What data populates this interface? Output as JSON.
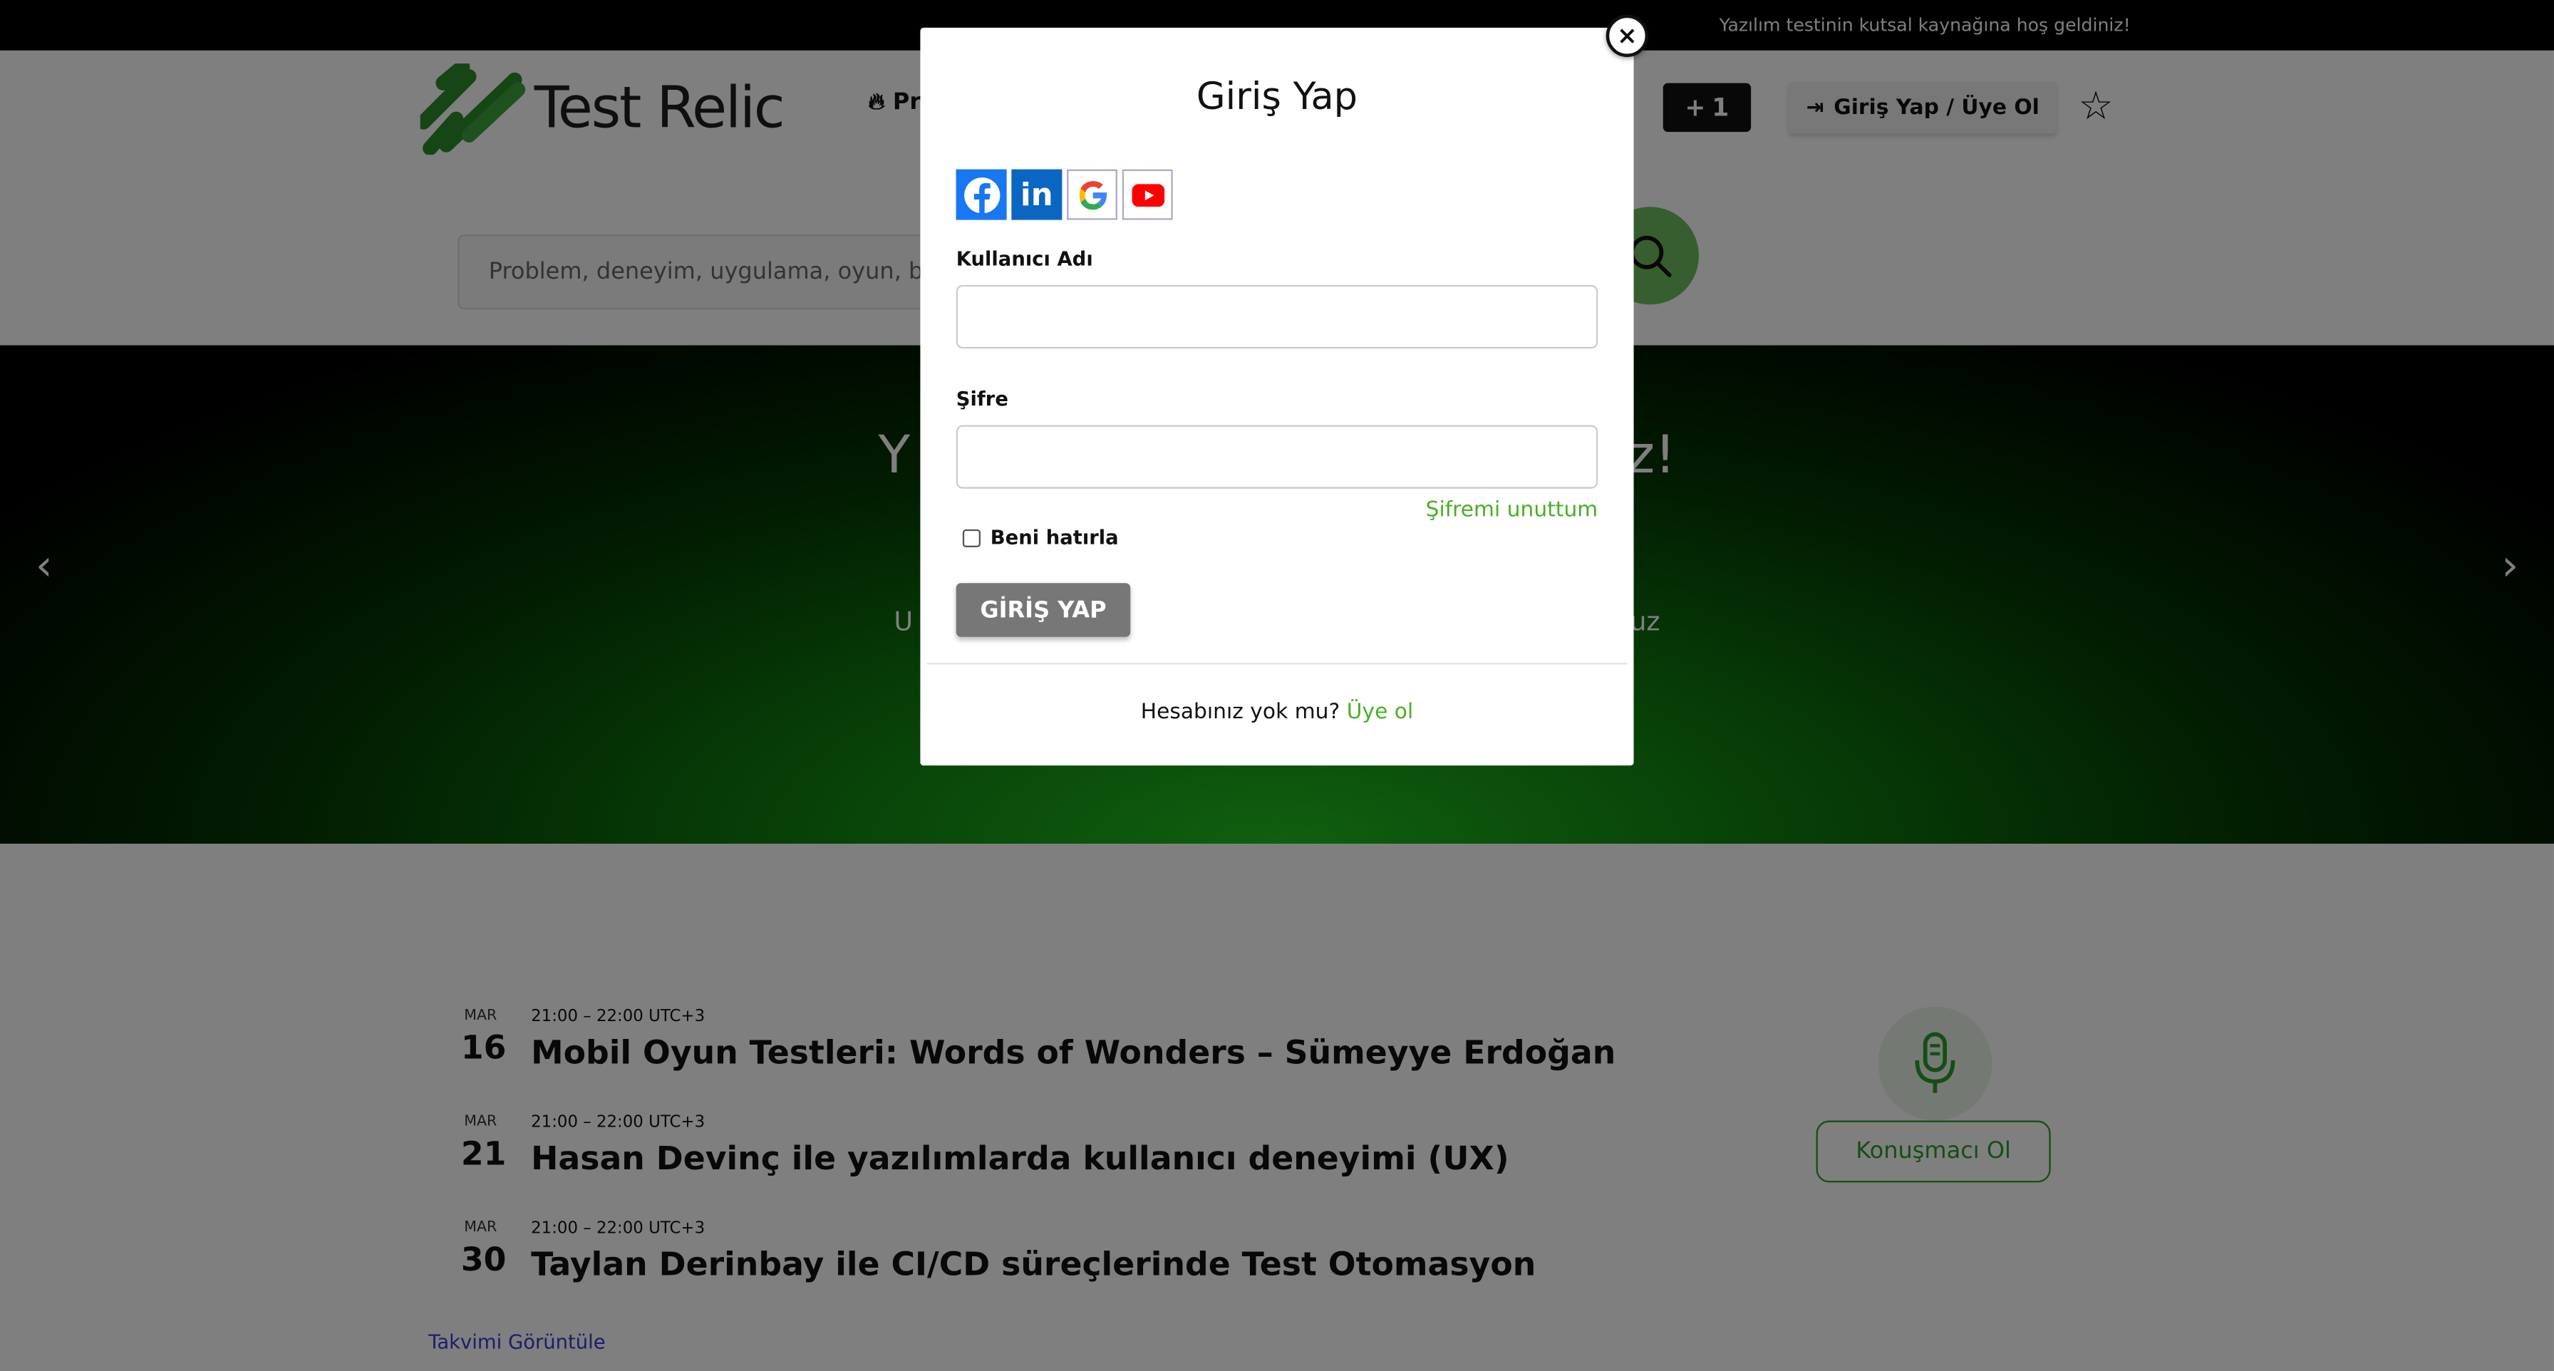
{
  "topbar": {
    "message": "Yazılım testinin kutsal kaynağına hoş geldiniz!"
  },
  "header": {
    "logo_text": "Test Relic",
    "nav_item": "Pr",
    "plus_label": "1",
    "login_label": "Giriş Yap / Üye Ol"
  },
  "search": {
    "placeholder": "Problem, deneyim, uygulama, oyun, blog"
  },
  "hero": {
    "title_left": "Y",
    "title_right": "z!",
    "sub_left": "U",
    "sub_right": "uz"
  },
  "events": [
    {
      "month": "MAR",
      "day": "16",
      "time": "21:00 – 22:00 UTC+3",
      "title": "Mobil Oyun Testleri: Words of Wonders – Sümeyye Erdoğan"
    },
    {
      "month": "MAR",
      "day": "21",
      "time": "21:00 – 22:00 UTC+3",
      "title": "Hasan Devinç ile yazılımlarda kullanıcı deneyimi (UX)"
    },
    {
      "month": "MAR",
      "day": "30",
      "time": "21:00 – 22:00 UTC+3",
      "title": "Taylan Derinbay ile CI/CD süreçlerinde Test Otomasyon"
    }
  ],
  "calendar_link": "Takvimi Görüntüle",
  "speaker_button": "Konuşmacı Ol",
  "modal": {
    "title": "Giriş Yap",
    "close": "×",
    "social_icons": [
      "facebook-icon",
      "linkedin-icon",
      "google-icon",
      "youtube-icon"
    ],
    "linkedin_text": "in",
    "username_label": "Kullanıcı Adı",
    "username_value": "",
    "password_label": "Şifre",
    "password_value": "",
    "forgot_label": "Şifremi unuttum",
    "remember_label": "Beni hatırla",
    "submit_label": "GİRİŞ YAP",
    "no_account_text": "Hesabınız yok mu?",
    "signup_link": "Üye ol"
  },
  "colors": {
    "brand_green": "#49b025",
    "overlay": "rgba(0,0,0,0.5)",
    "topbar": "#000000"
  }
}
